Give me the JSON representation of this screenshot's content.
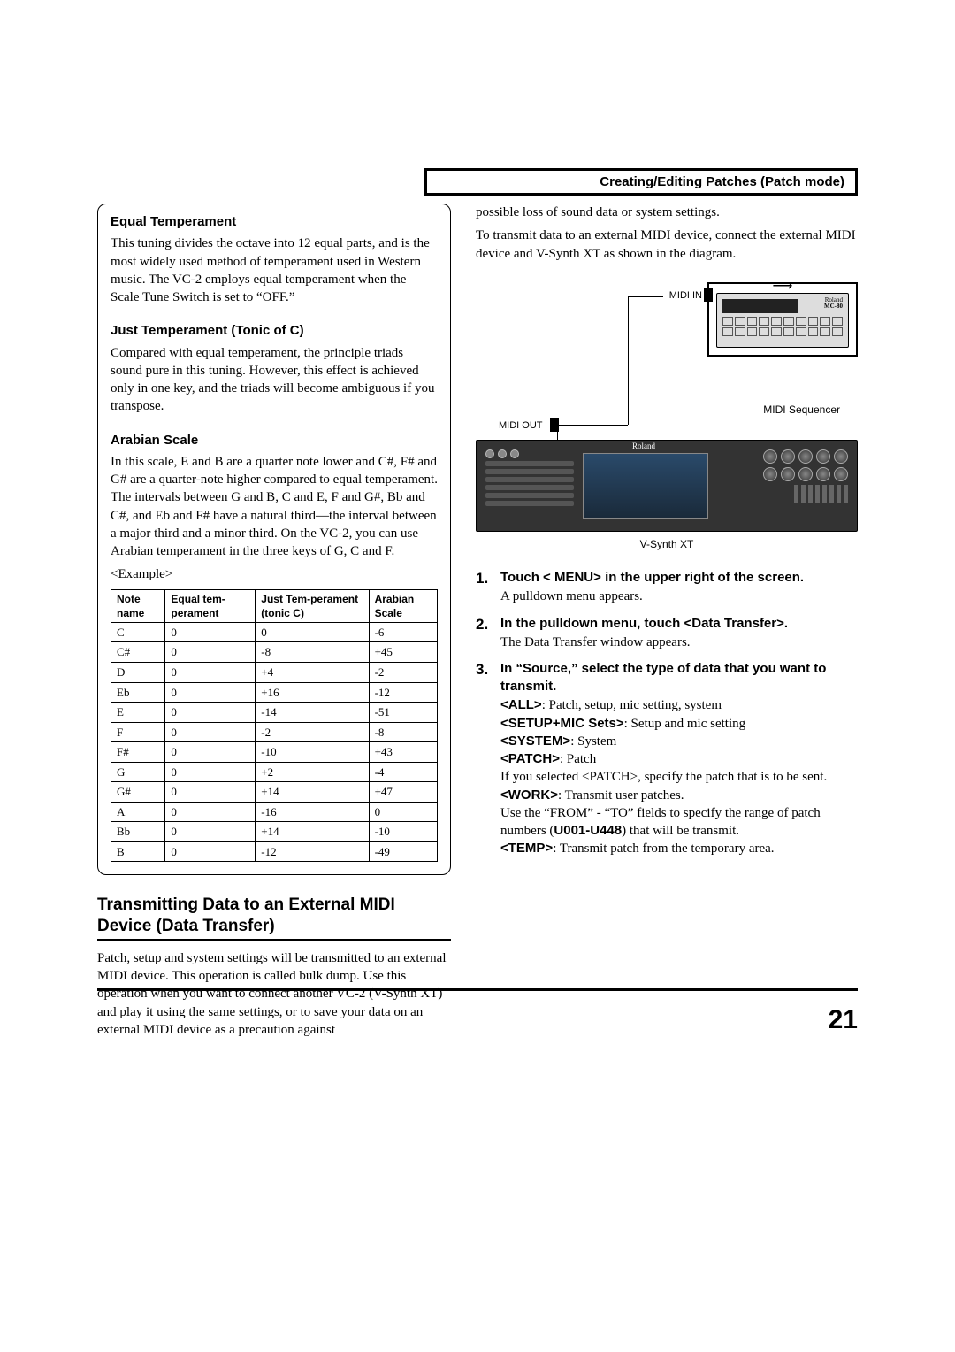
{
  "header": {
    "title": "Creating/Editing Patches (Patch mode)"
  },
  "left": {
    "equal": {
      "heading": "Equal Temperament",
      "text": "This tuning divides the octave into 12 equal parts, and is the most widely used method of temperament used in Western music. The VC-2 employs equal temperament when the Scale Tune Switch is set to “OFF.”"
    },
    "just": {
      "heading": "Just Temperament (Tonic of C)",
      "text": "Compared with equal temperament, the principle triads sound pure in this tuning. However, this effect is achieved only in one key, and the triads will become ambiguous if you transpose."
    },
    "arabian": {
      "heading": "Arabian Scale",
      "text": "In this scale, E and B are a quarter note lower and C#, F# and G# are a quarter-note higher compared to equal temperament. The intervals between G and B, C and E, F and G#, Bb and C#, and Eb and F# have a natural third—the interval between a major third and a minor third. On the VC-2, you can use Arabian temperament in the three keys of G, C and F."
    },
    "example_label": "<Example>",
    "table": {
      "headers": [
        "Note name",
        "Equal tem-perament",
        "Just Tem-perament (tonic C)",
        "Arabian Scale"
      ],
      "rows": [
        [
          "C",
          "0",
          "0",
          "-6"
        ],
        [
          "C#",
          "0",
          "-8",
          "+45"
        ],
        [
          "D",
          "0",
          "+4",
          "-2"
        ],
        [
          "Eb",
          "0",
          "+16",
          "-12"
        ],
        [
          "E",
          "0",
          "-14",
          "-51"
        ],
        [
          "F",
          "0",
          "-2",
          "-8"
        ],
        [
          "F#",
          "0",
          "-10",
          "+43"
        ],
        [
          "G",
          "0",
          "+2",
          "-4"
        ],
        [
          "G#",
          "0",
          "+14",
          "+47"
        ],
        [
          "A",
          "0",
          "-16",
          "0"
        ],
        [
          "Bb",
          "0",
          "+14",
          "-10"
        ],
        [
          "B",
          "0",
          "-12",
          "-49"
        ]
      ]
    },
    "transmit": {
      "heading": "Transmitting Data to an External MIDI Device (Data Transfer)",
      "text": "Patch, setup and system settings will be transmitted to an external MIDI device. This operation is called bulk dump. Use this operation when you want to connect another VC-2 (V-Synth XT) and play it using the same settings, or to save your data on an external MIDI device as a precaution against"
    }
  },
  "right": {
    "cont_text": "possible loss of sound data or system settings.",
    "cont_text2": "To transmit data to an external MIDI device, connect the external MIDI device and V-Synth XT as shown in the diagram.",
    "diagram": {
      "midi_in": "MIDI IN",
      "midi_out": "MIDI OUT",
      "seq_brand_top": "Roland",
      "seq_brand_bottom": "MC-80",
      "seq_caption": "MIDI Sequencer",
      "synth_brand_top": "Roland",
      "synth_brand_bottom": "V-Synth XT",
      "synth_caption": "V-Synth XT"
    },
    "steps": [
      {
        "head": "Touch < MENU> in the upper right of the screen.",
        "body": "A pulldown menu appears."
      },
      {
        "head": "In the pulldown menu, touch <Data Transfer>.",
        "body": "The Data Transfer window appears."
      },
      {
        "head": "In “Source,” select the type of data that you want to transmit.",
        "body_lines": [
          {
            "label": "<ALL>",
            "rest": ": Patch, setup, mic setting, system"
          },
          {
            "label": "<SETUP+MIC Sets>",
            "rest": ": Setup and mic setting"
          },
          {
            "label": "<SYSTEM>",
            "rest": ": System"
          },
          {
            "label": "<PATCH>",
            "rest": ": Patch"
          }
        ],
        "tail1": "If you selected <PATCH>, specify the patch that is to be sent.",
        "work": {
          "label": "<WORK>",
          "rest": ": Transmit user patches."
        },
        "tail2a": "Use the “FROM” - “TO” fields to specify the range of patch numbers (",
        "tail2b": "U001-U448",
        "tail2c": ") that will be transmit.",
        "temp": {
          "label": "<TEMP>",
          "rest": ": Transmit patch from the temporary area."
        }
      }
    ]
  },
  "page_number": "21"
}
